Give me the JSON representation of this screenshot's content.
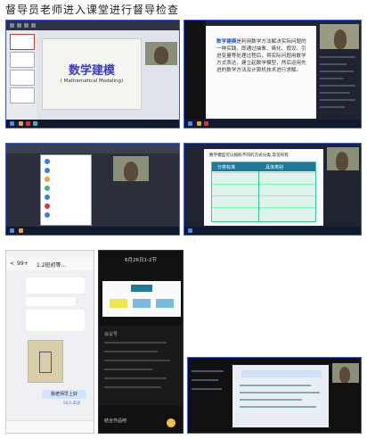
{
  "caption": "督导员老师进入课堂进行督导检查",
  "slide1": {
    "title": "数学建模",
    "subtitle": "( Mathematical Modeling)"
  },
  "slide2": {
    "highlight": "数学建模",
    "text": "是利用数学方法解决实际问题的一种实践。即通过抽象、简化、假设、引进变量等处理过程后，将实际问题用数学方式表达，建立起数学模型，然后运用先进的数学方法及计算机技术进行求解。"
  },
  "slide3": {
    "heading": "数学模型可以按照不同的方式分类,常见的有:",
    "col1": "分类标准",
    "col2": "具体类别"
  },
  "phone1": {
    "back": "<",
    "count": "99+",
    "title": "1.2班初等...",
    "button": "我老师早上好",
    "status": "56人未读"
  },
  "phone2": {
    "title": "6月26日1-2节",
    "meeting_label": "会议号",
    "footer": "结合作品吧"
  },
  "colors": {
    "accent": "#3b5bdb",
    "dark": "#1f2430",
    "slide_title": "#3a3ac8",
    "highlight": "#1a5fd0"
  }
}
